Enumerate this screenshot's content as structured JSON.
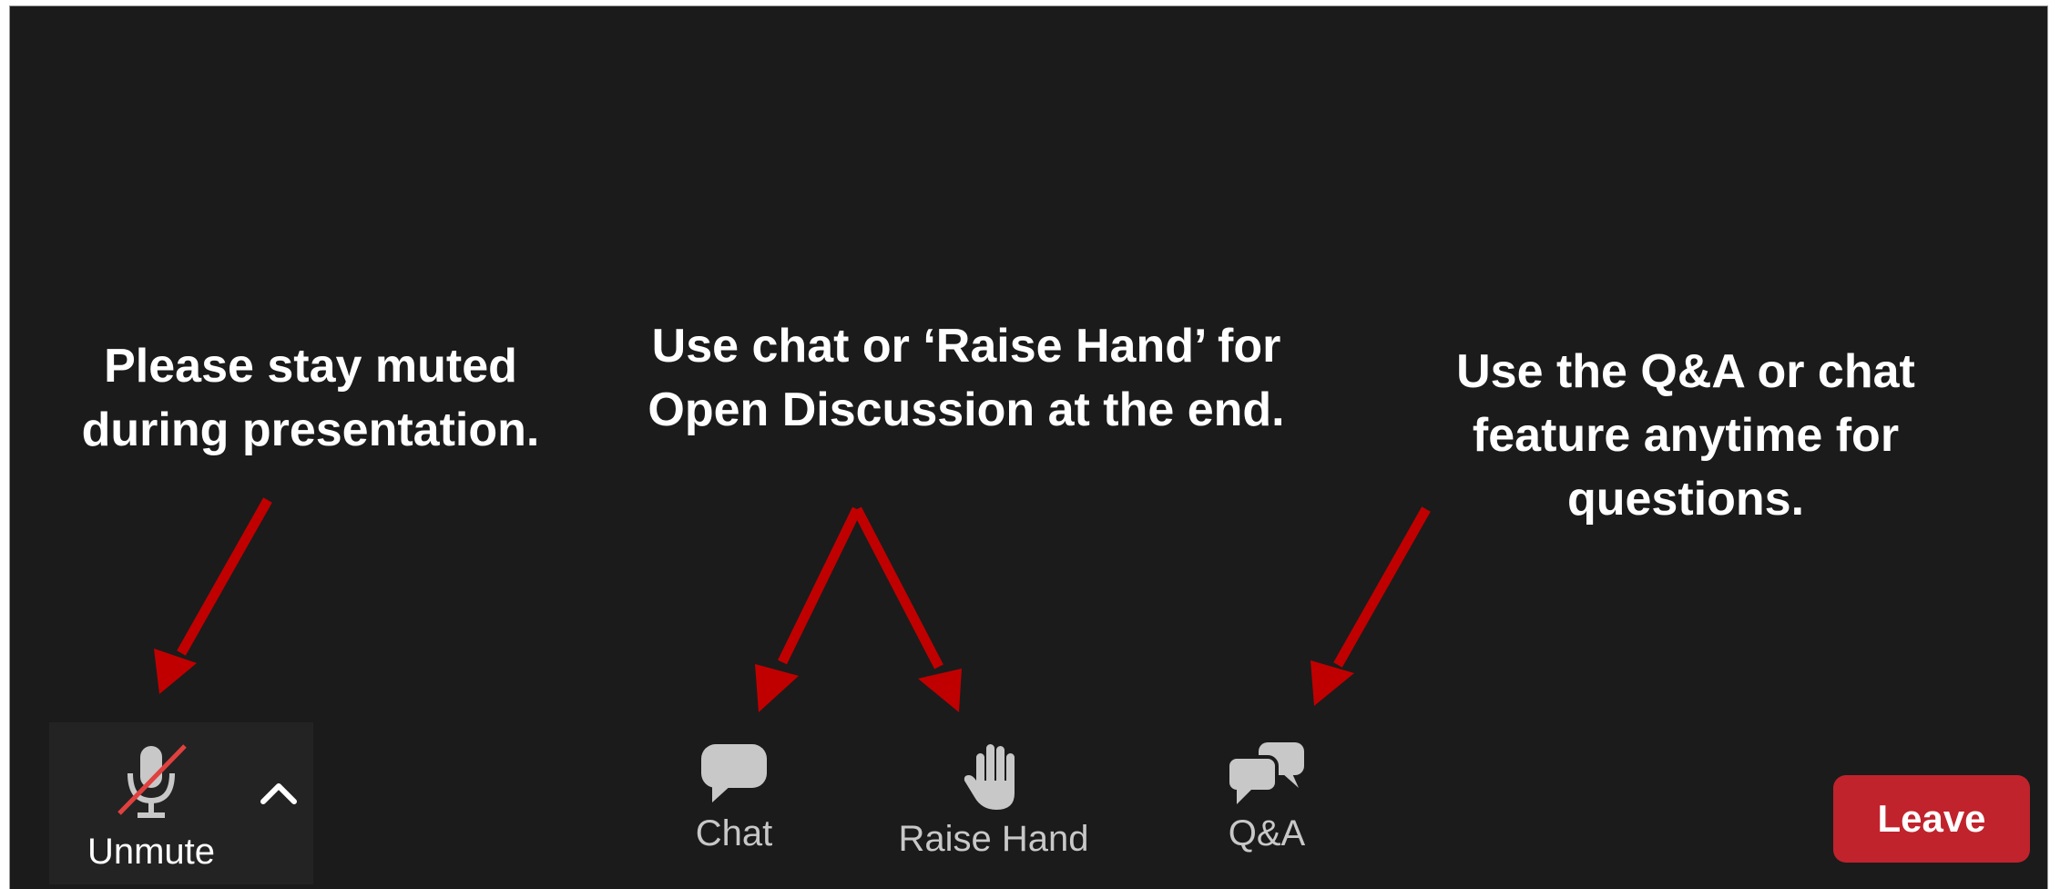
{
  "annotations": {
    "mute_note": "Please stay muted during presentation.",
    "chat_note": "Use chat or ‘Raise Hand’ for Open Discussion at the end.",
    "qa_note": "Use the Q&A or chat feature anytime for questions."
  },
  "toolbar": {
    "unmute_label": "Unmute",
    "chat_label": "Chat",
    "raise_hand_label": "Raise Hand",
    "qa_label": "Q&A",
    "leave_label": "Leave"
  },
  "colors": {
    "background": "#1b1b1b",
    "arrow": "#c00000",
    "leave_button": "#c0232c",
    "icon": "#c8c8c8",
    "mute_slash": "#e0413e"
  },
  "icons": [
    "microphone-muted-icon",
    "chevron-up-icon",
    "chat-bubble-icon",
    "raised-hand-icon",
    "qa-bubbles-icon"
  ]
}
